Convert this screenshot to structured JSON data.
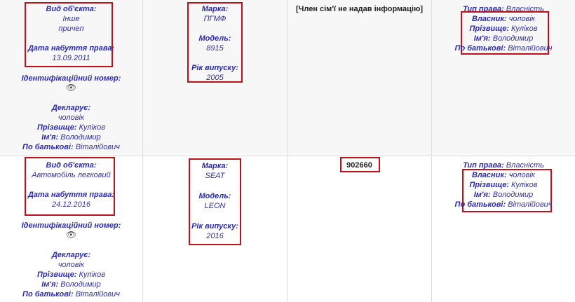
{
  "rows": [
    {
      "object": {
        "type_label": "Вид об'єкта:",
        "type_value_1": "Інше",
        "type_value_2": "причеп",
        "date_label": "Дата набуття права:",
        "date_value": "13.09.2011",
        "id_label": "Ідентифікаційний номер:",
        "id_icon": "eye-hidden-icon",
        "declarant_label": "Декларує:",
        "declarant_value": "чоловік",
        "surname_label": "Прізвище:",
        "surname_value": "Куліков",
        "name_label": "Ім'я:",
        "name_value": "Володимир",
        "patronymic_label": "По батькові:",
        "patronymic_value": "Віталійович"
      },
      "vehicle": {
        "brand_label": "Марка:",
        "brand_value": "ПГМФ",
        "model_label": "Модель:",
        "model_value": "8915",
        "year_label": "Рік випуску:",
        "year_value": "2005"
      },
      "cost": "[Член сім'ї не надав інформацію]",
      "right": {
        "type_label": "Тип права:",
        "type_value": "Власність",
        "owner_label": "Власник:",
        "owner_value": "чоловік",
        "surname_label": "Прізвище:",
        "surname_value": "Куліков",
        "name_label": "Ім'я:",
        "name_value": "Володимир",
        "patronymic_label": "По батькові:",
        "patronymic_value": "Віталійович"
      }
    },
    {
      "object": {
        "type_label": "Вид об'єкта:",
        "type_value_1": "Автомобіль легковий",
        "date_label": "Дата набуття права:",
        "date_value": "24.12.2016",
        "id_label": "Ідентифікаційний номер:",
        "id_icon": "eye-hidden-icon",
        "declarant_label": "Декларує:",
        "declarant_value": "чоловік",
        "surname_label": "Прізвище:",
        "surname_value": "Куліков",
        "name_label": "Ім'я:",
        "name_value": "Володимир",
        "patronymic_label": "По батькові:",
        "patronymic_value": "Віталійович"
      },
      "vehicle": {
        "brand_label": "Марка:",
        "brand_value": "SEAT",
        "model_label": "Модель:",
        "model_value": "LEON",
        "year_label": "Рік випуску:",
        "year_value": "2016"
      },
      "cost": "902660",
      "right": {
        "type_label": "Тип права:",
        "type_value": "Власність",
        "owner_label": "Власник:",
        "owner_value": "чоловік",
        "surname_label": "Прізвище:",
        "surname_value": "Куліков",
        "name_label": "Ім'я:",
        "name_value": "Володимир",
        "patronymic_label": "По батькові:",
        "patronymic_value": "Віталійович"
      }
    }
  ],
  "highlight_color": "#c0101a"
}
